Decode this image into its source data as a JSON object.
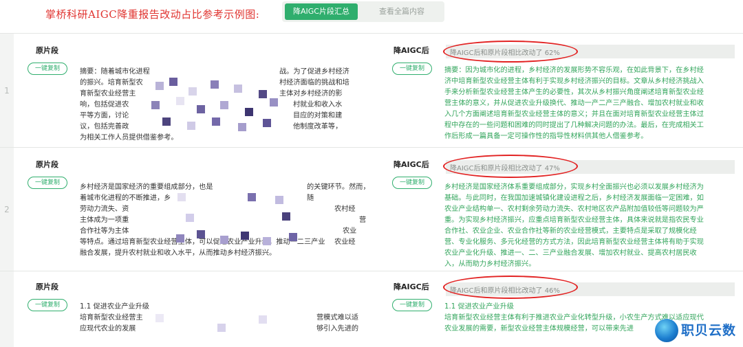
{
  "header": {
    "title": "掌桥科研AIGC降重报告改动占比参考示例图:",
    "tabs": [
      {
        "label": "降AIGC片段汇总",
        "active": true
      },
      {
        "label": "查看全篇内容",
        "active": false
      }
    ]
  },
  "rows": [
    {
      "number": "1",
      "left_label": "原片段",
      "right_label": "降AIGC后",
      "copy_label": "一键复制",
      "ratio_text": "降AIGC后和原片段相比改动了 62%",
      "ratio_percent": 62,
      "original_lines": [
        "摘要：随着城市化进程",
        "的振兴。培育新型农",
        "育新型农业经营主",
        "响，包括促进农",
        "平等方面，讨论",
        "议，包括完善政",
        "为相关工作人员提供借鉴参考。"
      ],
      "original_right_fragments": [
        "战。为了促进乡村经济",
        "村经济面临的挑战和培",
        "主体对乡村经济的影",
        "村就业和收入水",
        "目应的对策和建",
        "他制度改革等，"
      ],
      "revised_lines": [
        "摘要：因为城市化的进程，乡村经济的发展形势不容乐观，在如此背景下，在乡村经",
        "济中培育新型农业经营主体有利于实现乡村经济振兴的目标。文章从乡村经济挑战入",
        "手来分析新型农业经营主体产生的必要性，其次从乡村振兴角度阐述培育新型农业经",
        "营主体的意义，并从促进农业升级换代、推动一产二产三产融合、增加农村就业和收",
        "入几个方面阐述培育新型农业经营主体的意义；并且在面对培育新型农业经营主体过",
        "程中存在的一些问题和困难的同时提出了几种解决问题的办法。最后，在完成相关工",
        "作后形成一篇具备一定可操作性的指导性材料供其他人借鉴参考。"
      ]
    },
    {
      "number": "2",
      "left_label": "原片段",
      "right_label": "降AIGC后",
      "copy_label": "一键复制",
      "ratio_text": "降AIGC后和原片段相比改动了 47%",
      "ratio_percent": 47,
      "original_lines": [
        "乡村经济是国家经济的重要组成部分，也是",
        "着城市化进程的不断推进，乡",
        "劳动力流失、资",
        "主体成为一项重",
        "合作社等为主体",
        "等特点。通过培育新型农业经营主体，可以促进农业产业升级，推动一二三产业",
        "融合发展，提升农村就业和收入水平，从而推动乡村经济振兴。"
      ],
      "original_right_fragments": [
        "的关键环节。然而，随",
        "农村经",
        "营",
        "农业",
        "农业经"
      ],
      "revised_lines": [
        "乡村经济是国家经济体系重要组成部分，实现乡村全面振兴也必须以发展乡村经济为",
        "基础。与此同时，在我国加速城镇化建设进程之后，乡村经济发展面临一定困难，如",
        "农业产业结构单一、农村剩余劳动力流失、农村地区农产品附加值较低等问题较为严",
        "重。为实现乡村经济振兴，应重点培育新型农业经营主体，具体来说就是指农民专业",
        "合作社、农业企业、农业合作社等新的农业经营模式，主要特点是采取了规模化经",
        "营、专业化服务、多元化经营的方式方法，因此培育新型农业经营主体将有助于实现",
        "农业产业化升级、推进一、二、三产业融合发展、增加农村就业、提高农村居民收",
        "入，从而助力乡村经济振兴。"
      ]
    },
    {
      "number": "",
      "left_label": "原片段",
      "right_label": "降AIGC后",
      "copy_label": "一键复制",
      "ratio_text": "降AIGC后和原片段相比改动了 46%",
      "ratio_percent": 46,
      "original_lines": [
        "1.1 促进农业产业升级",
        "培育新型农业经营主",
        "应现代农业的发展"
      ],
      "original_right_fragments": [
        "营模式难以适",
        "够引入先进的"
      ],
      "revised_lines": [
        "1.1 促进农业产业升级",
        "培育新型农业经营主体有利于推进农业产业化转型升级，小农生产方式难以适应现代",
        "农业发展的需要，新型农业经营主体规模经营，可以带来先进"
      ]
    }
  ],
  "watermark": {
    "text": "职贝云数"
  },
  "colors": {
    "accent": "#2fae6d",
    "title_red": "#e0332f",
    "revised_text": "#33a55c",
    "ellipse": "#e22222"
  }
}
